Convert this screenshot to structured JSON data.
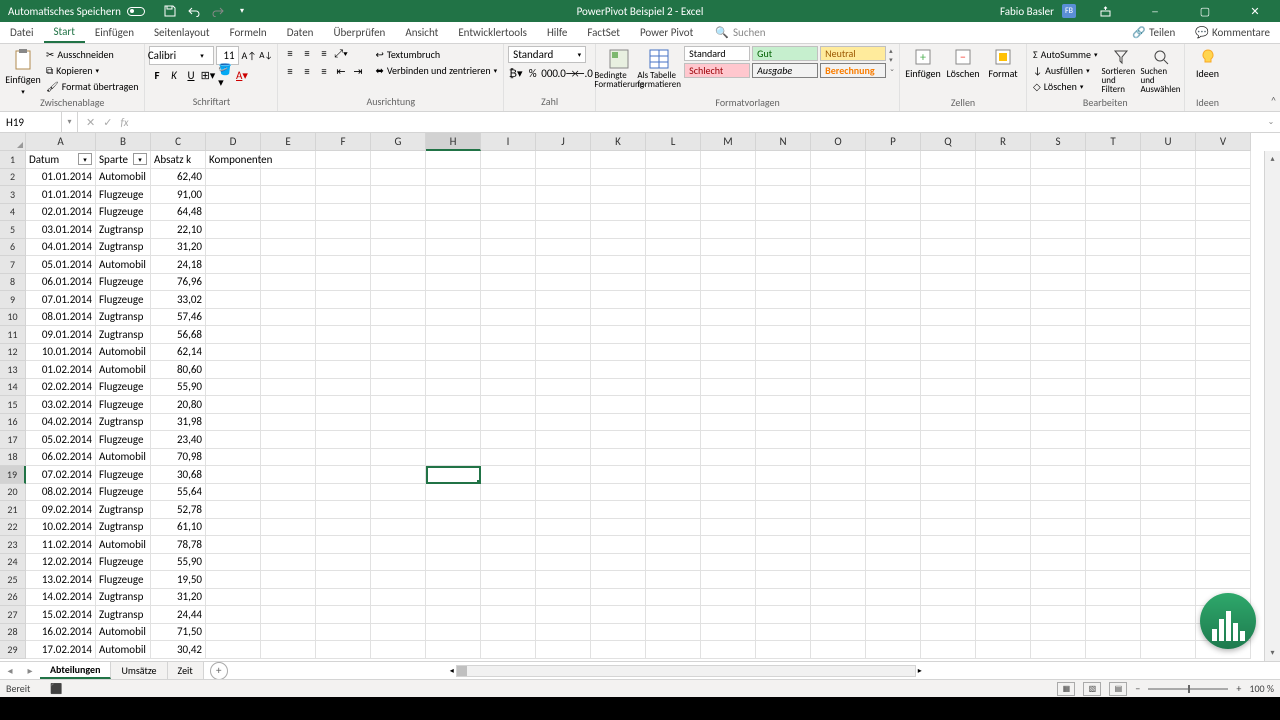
{
  "app": {
    "autosave_label": "Automatisches Speichern",
    "title": "PowerPivot Beispiel 2 - Excel",
    "user": "Fabio Basler",
    "user_initials": "FB"
  },
  "ribbon_tabs": [
    "Datei",
    "Start",
    "Einfügen",
    "Seitenlayout",
    "Formeln",
    "Daten",
    "Überprüfen",
    "Ansicht",
    "Entwicklertools",
    "Hilfe",
    "FactSet",
    "Power Pivot"
  ],
  "ribbon_tabs_active": 1,
  "search_placeholder": "Suchen",
  "right_tabs": {
    "share": "Teilen",
    "comments": "Kommentare"
  },
  "groups": {
    "clipboard": {
      "label": "Zwischenablage",
      "paste": "Einfügen",
      "cut": "Ausschneiden",
      "copy": "Kopieren",
      "format_painter": "Format übertragen"
    },
    "font": {
      "label": "Schriftart",
      "name": "Calibri",
      "size": "11"
    },
    "align": {
      "label": "Ausrichtung",
      "wrap": "Textumbruch",
      "merge": "Verbinden und zentrieren"
    },
    "number": {
      "label": "Zahl",
      "format": "Standard"
    },
    "styles": {
      "label": "Formatvorlagen",
      "cond": "Bedingte Formatierung",
      "table": "Als Tabelle formatieren",
      "s1": "Standard",
      "s2": "Gut",
      "s3": "Neutral",
      "s4": "Schlecht",
      "s5": "Ausgabe",
      "s6": "Berechnung"
    },
    "cells": {
      "label": "Zellen",
      "insert": "Einfügen",
      "delete": "Löschen",
      "format": "Format"
    },
    "editing": {
      "label": "Bearbeiten",
      "sum": "AutoSumme",
      "fill": "Ausfüllen",
      "clear": "Löschen",
      "sort": "Sortieren und Filtern",
      "find": "Suchen und Auswählen"
    },
    "ideas": {
      "label": "Ideen",
      "btn": "Ideen"
    }
  },
  "namebox": "H19",
  "columns": [
    "A",
    "B",
    "C",
    "D",
    "E",
    "F",
    "G",
    "H",
    "I",
    "J",
    "K",
    "L",
    "M",
    "N",
    "O",
    "P",
    "Q",
    "R",
    "S",
    "T",
    "U",
    "V"
  ],
  "selected_col": 7,
  "selected_row": 19,
  "headers": [
    "Datum",
    "Sparte",
    "Absatz k",
    "Komponenten"
  ],
  "data_rows": [
    [
      "01.01.2014",
      "Automobil",
      "62,40"
    ],
    [
      "01.01.2014",
      "Flugzeuge",
      "91,00"
    ],
    [
      "02.01.2014",
      "Flugzeuge",
      "64,48"
    ],
    [
      "03.01.2014",
      "Zugtransp",
      "22,10"
    ],
    [
      "04.01.2014",
      "Zugtransp",
      "31,20"
    ],
    [
      "05.01.2014",
      "Automobil",
      "24,18"
    ],
    [
      "06.01.2014",
      "Flugzeuge",
      "76,96"
    ],
    [
      "07.01.2014",
      "Flugzeuge",
      "33,02"
    ],
    [
      "08.01.2014",
      "Zugtransp",
      "57,46"
    ],
    [
      "09.01.2014",
      "Zugtransp",
      "56,68"
    ],
    [
      "10.01.2014",
      "Automobil",
      "62,14"
    ],
    [
      "01.02.2014",
      "Automobil",
      "80,60"
    ],
    [
      "02.02.2014",
      "Flugzeuge",
      "55,90"
    ],
    [
      "03.02.2014",
      "Flugzeuge",
      "20,80"
    ],
    [
      "04.02.2014",
      "Zugtransp",
      "31,98"
    ],
    [
      "05.02.2014",
      "Flugzeuge",
      "23,40"
    ],
    [
      "06.02.2014",
      "Automobil",
      "70,98"
    ],
    [
      "07.02.2014",
      "Flugzeuge",
      "30,68"
    ],
    [
      "08.02.2014",
      "Flugzeuge",
      "55,64"
    ],
    [
      "09.02.2014",
      "Zugtransp",
      "52,78"
    ],
    [
      "10.02.2014",
      "Zugtransp",
      "61,10"
    ],
    [
      "11.02.2014",
      "Automobil",
      "78,78"
    ],
    [
      "12.02.2014",
      "Flugzeuge",
      "55,90"
    ],
    [
      "13.02.2014",
      "Flugzeuge",
      "19,50"
    ],
    [
      "14.02.2014",
      "Zugtransp",
      "31,20"
    ],
    [
      "15.02.2014",
      "Zugtransp",
      "24,44"
    ],
    [
      "16.02.2014",
      "Automobil",
      "71,50"
    ],
    [
      "17.02.2014",
      "Automobil",
      "30,42"
    ]
  ],
  "sheets": [
    "Abteilungen",
    "Umsätze",
    "Zeit"
  ],
  "active_sheet": 0,
  "status": {
    "ready": "Bereit",
    "zoom": "100 %"
  }
}
